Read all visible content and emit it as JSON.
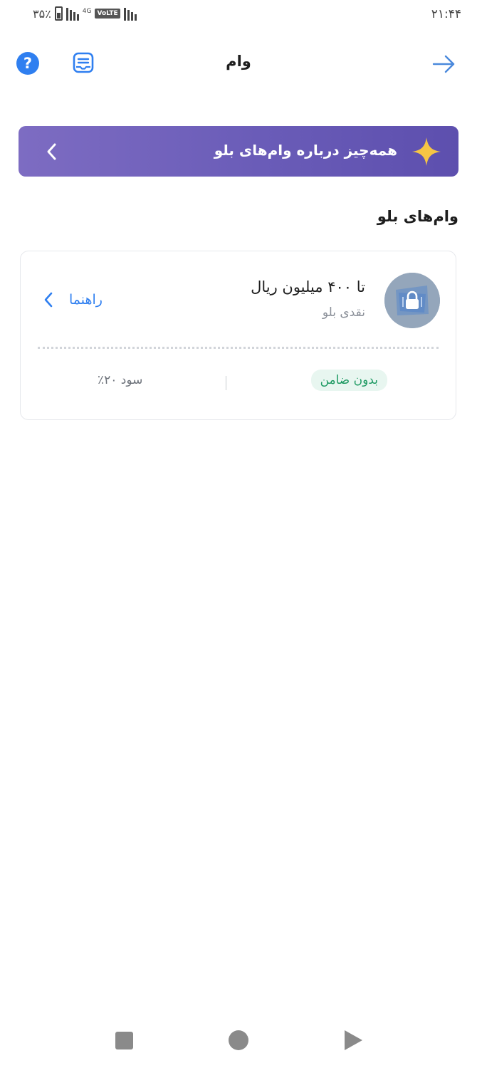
{
  "status_bar": {
    "time": "۲۱:۴۴",
    "battery": "۳۵٪",
    "network": "4G",
    "volte": "VoLTE"
  },
  "header": {
    "title": "وام",
    "back_icon": "arrow-right-icon",
    "receipt_icon": "receipt-icon",
    "help_icon_glyph": "?"
  },
  "banner": {
    "text": "همه‌چیز درباره وام‌های بلو",
    "icon": "sparkle-icon",
    "accent": "#f6c544"
  },
  "section": {
    "title": "وام‌های بلو"
  },
  "loan_card": {
    "amount": "تا ۴۰۰ میلیون ریال",
    "type": "نقدی بلو",
    "guide_label": "راهنما",
    "badge": "بدون ضامن",
    "interest": "سود ۲۰٪"
  },
  "colors": {
    "accent": "#2f7ff0",
    "banner_start": "#7d6cc2",
    "banner_end": "#5d4fae",
    "badge_bg": "#e8f6f0",
    "badge_text": "#1f9a63"
  }
}
